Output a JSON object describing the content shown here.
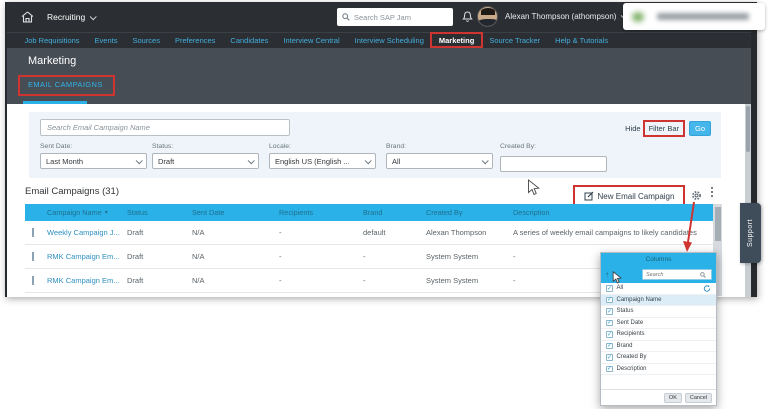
{
  "colors": {
    "annotation_red": "#cf3430",
    "header_cyan": "#2ab2e8",
    "link_blue": "#2e8fc2",
    "shell_dark": "#2b2f33",
    "page_header_gray": "#474d55",
    "filter_panel_bg": "#eef4f9",
    "go_button_cyan": "#45b6ea"
  },
  "shellbar": {
    "module_label": "Recruiting",
    "search_placeholder": "Search SAP Jam",
    "user_name": "Alexan Thompson (athompson)"
  },
  "nav": {
    "items": [
      "Job Requisitions",
      "Events",
      "Sources",
      "Preferences",
      "Candidates",
      "Interview Central",
      "Interview Scheduling",
      "Marketing",
      "Source Tracker",
      "Help & Tutorials"
    ],
    "active": "Marketing"
  },
  "page": {
    "title": "Marketing",
    "active_tab": "EMAIL CAMPAIGNS"
  },
  "filter_bar": {
    "search_placeholder": "Search Email Campaign Name",
    "hide_prefix": "Hide",
    "hide_highlighted": "Filter Bar",
    "go_label": "Go",
    "fields": [
      {
        "label": "Sent Date:",
        "value": "Last Month"
      },
      {
        "label": "Status:",
        "value": "Draft"
      },
      {
        "label": "Locale:",
        "value": "English US (English ..."
      },
      {
        "label": "Brand:",
        "value": "All"
      },
      {
        "label": "Created By:",
        "value": ""
      }
    ]
  },
  "list": {
    "title": "Email Campaigns (31)",
    "new_campaign_label": "New Email Campaign"
  },
  "table": {
    "columns": [
      "Campaign Name",
      "Status",
      "Sent Date",
      "Recipients",
      "Brand",
      "Created By",
      "Description"
    ],
    "rows": [
      {
        "name": "Weekly Campaign J...",
        "status": "Draft",
        "sent_date": "N/A",
        "recipients": "-",
        "brand": "default",
        "created_by": "Alexan Thompson",
        "description": "A series of weekly email campaigns to likely candidates"
      },
      {
        "name": "RMK Campaign Em...",
        "status": "Draft",
        "sent_date": "N/A",
        "recipients": "-",
        "brand": "-",
        "created_by": "System System",
        "description": "-"
      },
      {
        "name": "RMK Campaign Em...",
        "status": "Draft",
        "sent_date": "N/A",
        "recipients": "-",
        "brand": "-",
        "created_by": "System System",
        "description": "-"
      }
    ]
  },
  "columns_popup": {
    "title": "Columns",
    "search_placeholder": "Search",
    "items": [
      "All",
      "Campaign Name",
      "Status",
      "Sent Date",
      "Recipients",
      "Brand",
      "Created By",
      "Description"
    ],
    "ok_label": "OK",
    "cancel_label": "Cancel"
  },
  "support_tab_label": "Support"
}
